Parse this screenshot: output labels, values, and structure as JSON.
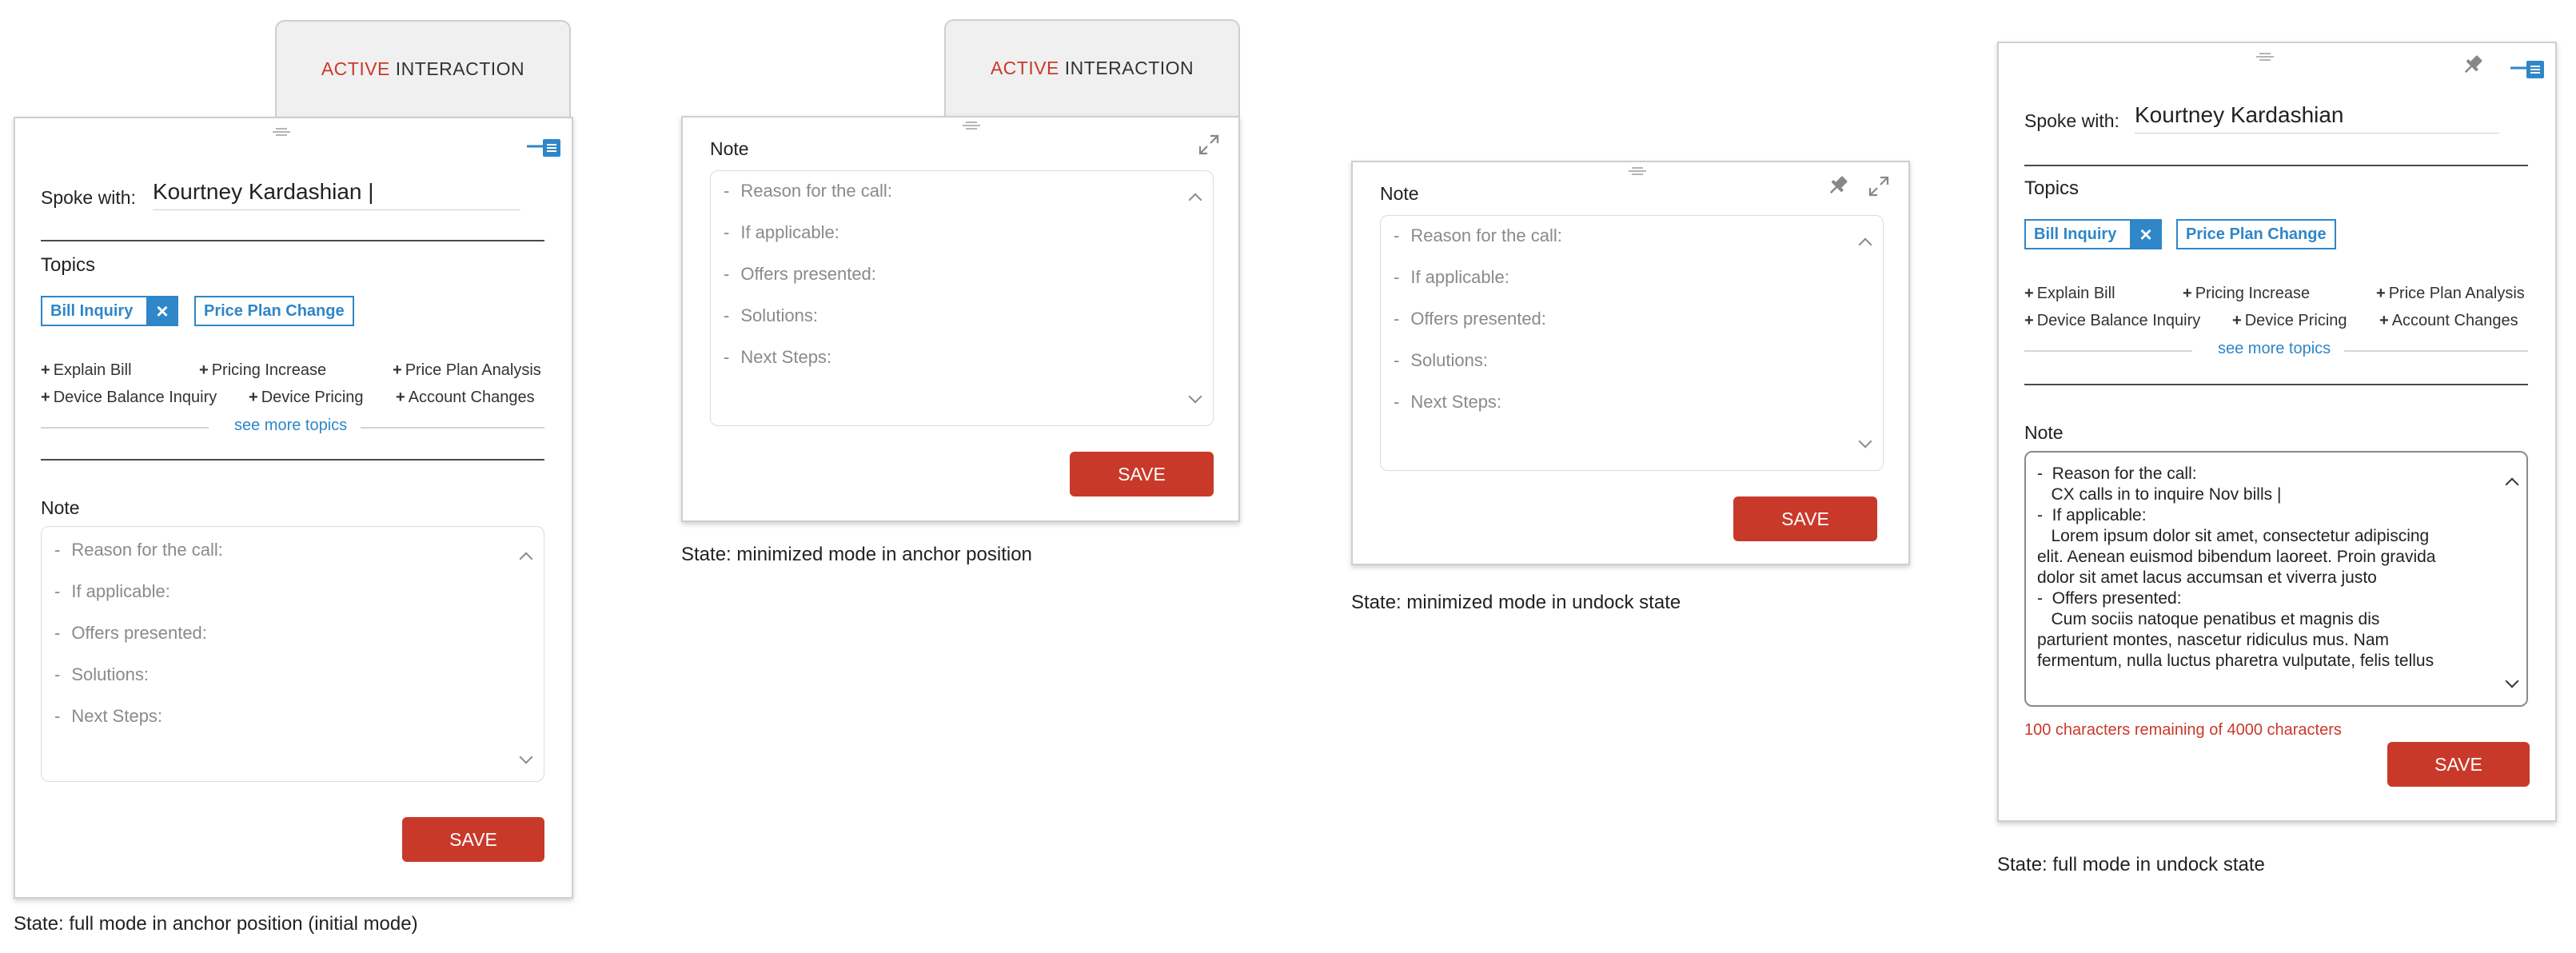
{
  "tab": {
    "highlight": "ACTIVE",
    "rest": " INTERACTION"
  },
  "spoke": {
    "label": "Spoke with:",
    "value_cursor": "Kourtney Kardashian |",
    "value": "Kourtney Kardashian"
  },
  "topics": {
    "heading": "Topics",
    "selected": [
      "Bill Inquiry",
      "Price Plan Change"
    ],
    "remove_symbol": "×",
    "suggested_row1": [
      "Explain Bill",
      "Pricing Increase",
      "Price Plan Analysis"
    ],
    "suggested_row2": [
      "Device Balance Inquiry",
      "Device Pricing",
      "Account Changes"
    ],
    "plus": "+",
    "see_more": "see more topics"
  },
  "note": {
    "label": "Note",
    "placeholders": [
      "Reason for the call:",
      "If applicable:",
      "Offers presented:",
      "Solutions:",
      "Next Steps:"
    ],
    "dash": "-",
    "filled_lines": [
      "-  Reason for the call:",
      "   CX calls in to inquire Nov bills |",
      "-  If applicable:",
      "   Lorem ipsum dolor sit amet, consectetur adipiscing",
      "elit. Aenean euismod bibendum laoreet. Proin gravida",
      "dolor sit amet lacus accumsan et viverra justo",
      "-  Offers presented:",
      "   Cum sociis natoque penatibus et magnis dis",
      "parturient montes, nascetur ridiculus mus. Nam",
      "fermentum, nulla luctus pharetra vulputate, felis tellus"
    ],
    "remaining": "100 characters remaining of 4000 characters"
  },
  "save_label": "SAVE",
  "captions": {
    "full_anchor": "State: full mode in anchor position (initial mode)",
    "min_anchor": "State: minimized mode in anchor position",
    "min_undock": "State: minimized mode in undock state",
    "full_undock": "State: full mode in undock state"
  },
  "icons": {
    "dock": "dock-icon",
    "pin": "pin-icon",
    "expand": "expand-icon"
  },
  "colors": {
    "accent_red": "#c9392a",
    "chip_blue": "#2f86c8",
    "tab_red": "#c73a2b"
  }
}
